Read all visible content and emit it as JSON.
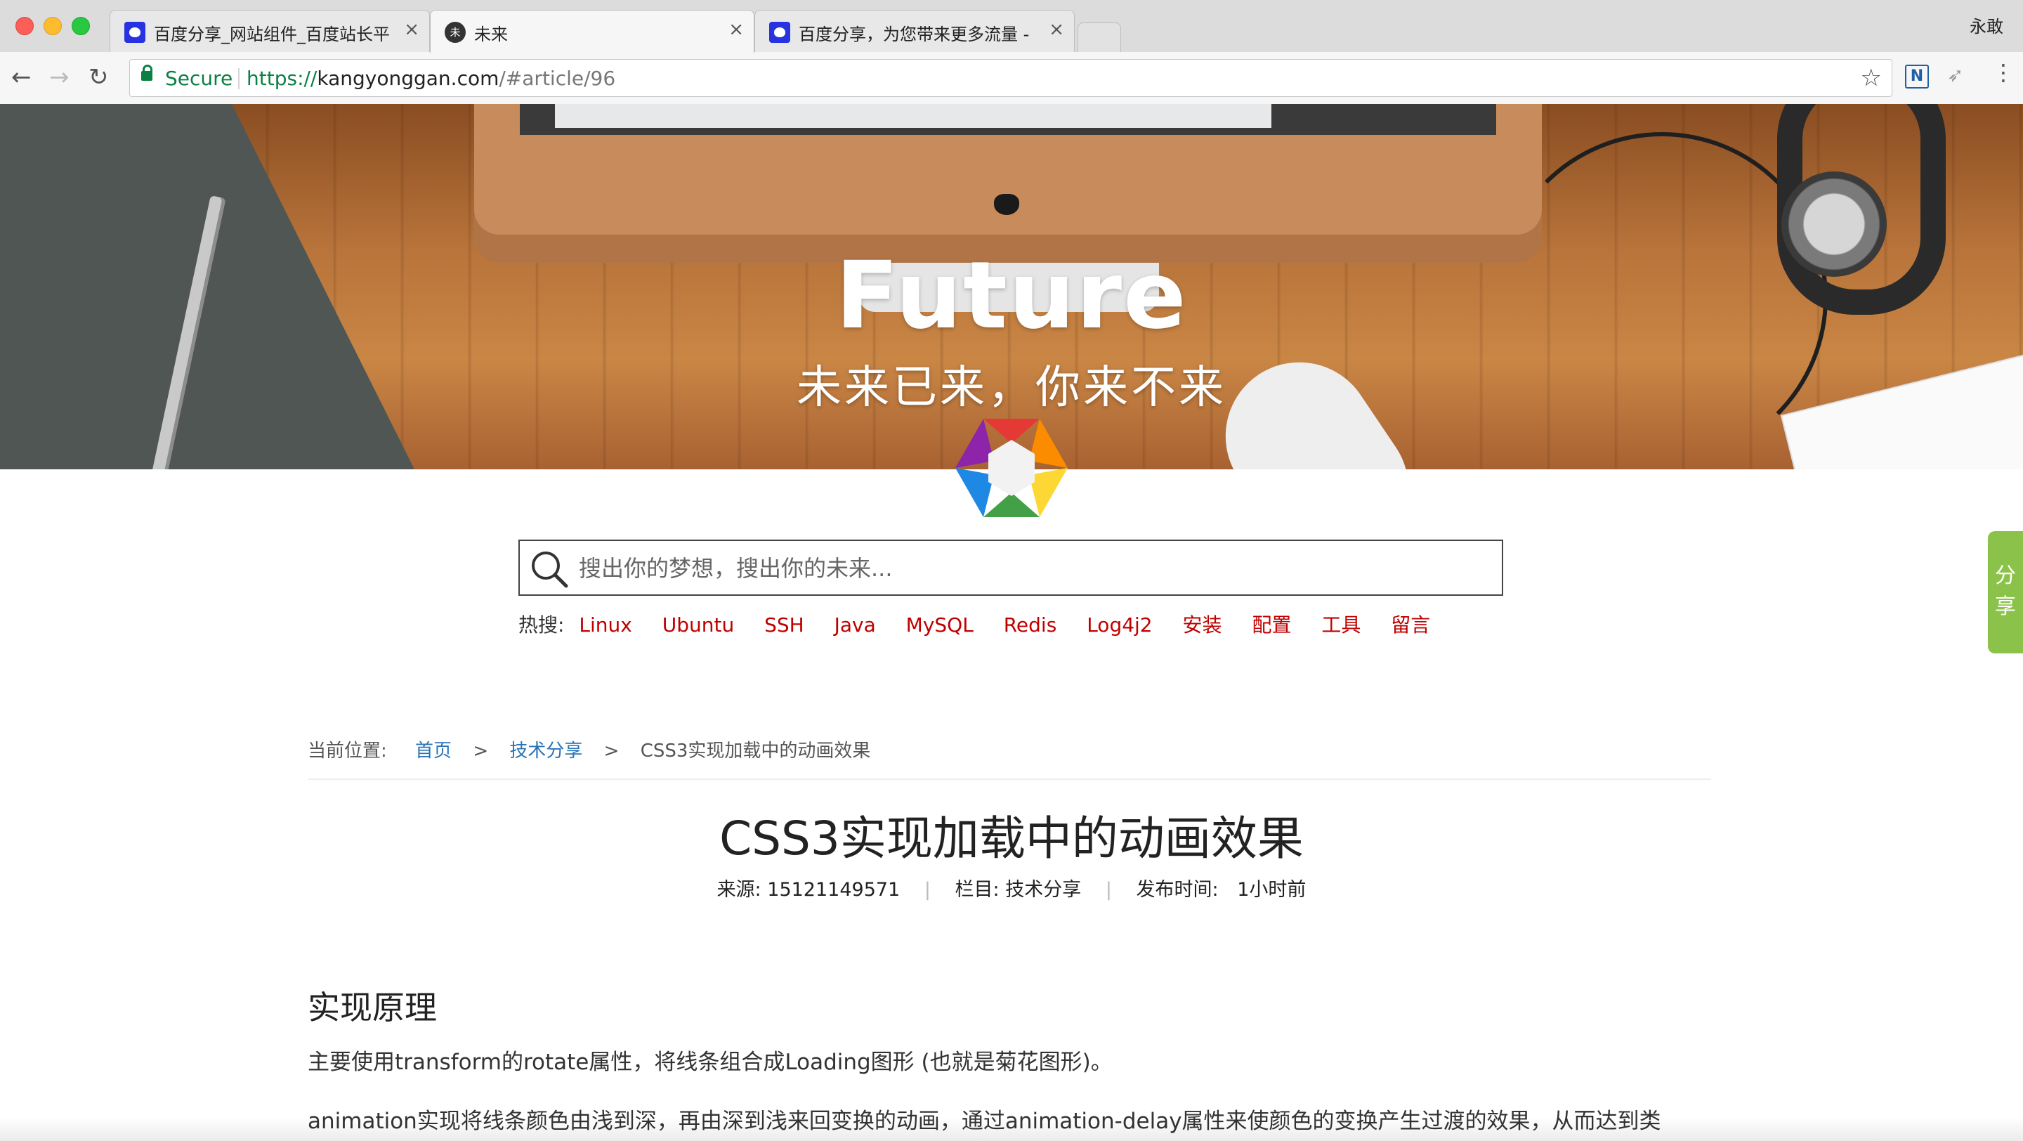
{
  "browser": {
    "tabs": [
      {
        "title": "百度分享_网站组件_百度站长平",
        "favicon": "baidu-paw-icon",
        "active": false
      },
      {
        "title": "未来",
        "favicon": "future-site-icon",
        "favicon_char": "未",
        "active": true
      },
      {
        "title": "百度分享，为您带来更多流量 -",
        "favicon": "baidu-paw-icon",
        "active": false
      }
    ],
    "tab_close_glyph": "×",
    "profile_name": "永敢",
    "secure_label": "Secure",
    "url": {
      "scheme": "https://",
      "host": "kangyonggan.com",
      "path": "/#article/96"
    }
  },
  "hero": {
    "title": "Future",
    "subtitle": "未来已来，你来不来"
  },
  "search": {
    "placeholder": "搜出你的梦想，搜出你的未来..."
  },
  "hot_search": {
    "label": "热搜:",
    "items": [
      "Linux",
      "Ubuntu",
      "SSH",
      "Java",
      "MySQL",
      "Redis",
      "Log4j2",
      "安装",
      "配置",
      "工具",
      "留言"
    ]
  },
  "share_tab": {
    "line1": "分",
    "line2": "享"
  },
  "breadcrumb": {
    "prefix": "当前位置:",
    "items": [
      "首页",
      "技术分享"
    ],
    "current": "CSS3实现加载中的动画效果",
    "separator": ">"
  },
  "article": {
    "title": "CSS3实现加载中的动画效果",
    "meta": {
      "source_label": "来源:",
      "source": "15121149571",
      "column_label": "栏目:",
      "column": "技术分享",
      "time_label": "发布时间:",
      "time": "1小时前",
      "divider": "|"
    },
    "section_heading": "实现原理",
    "paragraphs": [
      "主要使用transform的rotate属性，将线条组合成Loading图形 (也就是菊花图形)。",
      "animation实现将线条颜色由浅到深，再由深到浅来回变换的动画，通过animation-delay属性来使颜色的变换产生过渡的效果，从而达到类"
    ]
  },
  "colors": {
    "link_red": "#c00000",
    "link_blue": "#2b74b7",
    "secure_green": "#0b8043",
    "share_green": "#8bc34a"
  }
}
